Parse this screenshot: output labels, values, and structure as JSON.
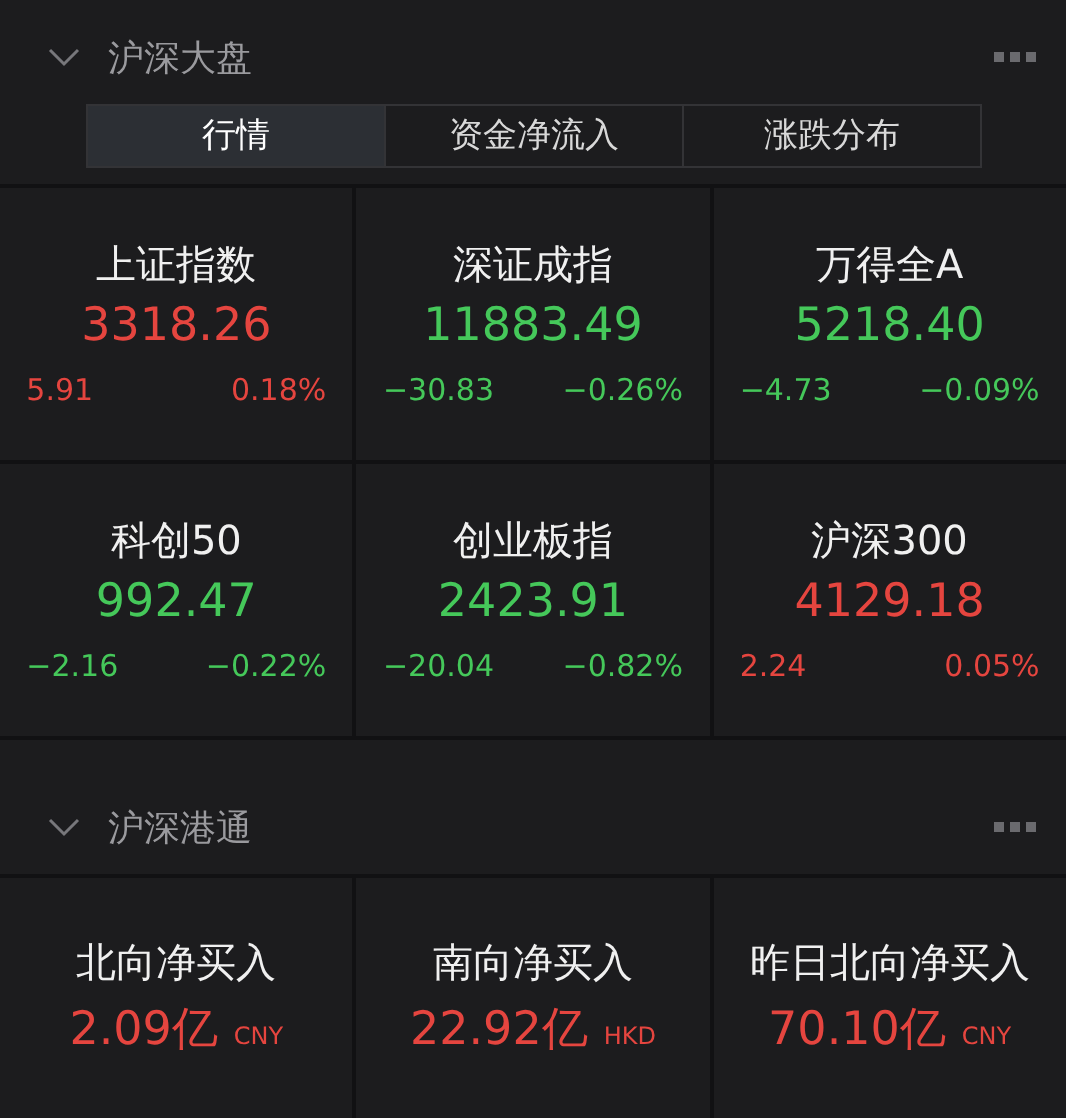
{
  "sections": [
    {
      "title": "沪深大盘",
      "expanded": true,
      "tabs": [
        {
          "label": "行情",
          "selected": true
        },
        {
          "label": "资金净流入",
          "selected": false
        },
        {
          "label": "涨跌分布",
          "selected": false
        }
      ],
      "indices": [
        {
          "name": "上证指数",
          "value": "3318.26",
          "change": "5.91",
          "percent": "0.18%",
          "color": "#e5453f"
        },
        {
          "name": "深证成指",
          "value": "11883.49",
          "change": "−30.83",
          "percent": "−0.26%",
          "color": "#45c85a"
        },
        {
          "name": "万得全A",
          "value": "5218.40",
          "change": "−4.73",
          "percent": "−0.09%",
          "color": "#45c85a"
        },
        {
          "name": "科创50",
          "value": "992.47",
          "change": "−2.16",
          "percent": "−0.22%",
          "color": "#45c85a"
        },
        {
          "name": "创业板指",
          "value": "2423.91",
          "change": "−20.04",
          "percent": "−0.82%",
          "color": "#45c85a"
        },
        {
          "name": "沪深300",
          "value": "4129.18",
          "change": "2.24",
          "percent": "0.05%",
          "color": "#e5453f"
        }
      ]
    },
    {
      "title": "沪深港通",
      "expanded": true,
      "flows": [
        {
          "name": "北向净买入",
          "value": "2.09亿",
          "currency": "CNY",
          "color": "#e5453f"
        },
        {
          "name": "南向净买入",
          "value": "22.92亿",
          "currency": "HKD",
          "color": "#e5453f"
        },
        {
          "name": "昨日北向净买入",
          "value": "70.10亿",
          "currency": "CNY",
          "color": "#e5453f"
        }
      ]
    }
  ]
}
